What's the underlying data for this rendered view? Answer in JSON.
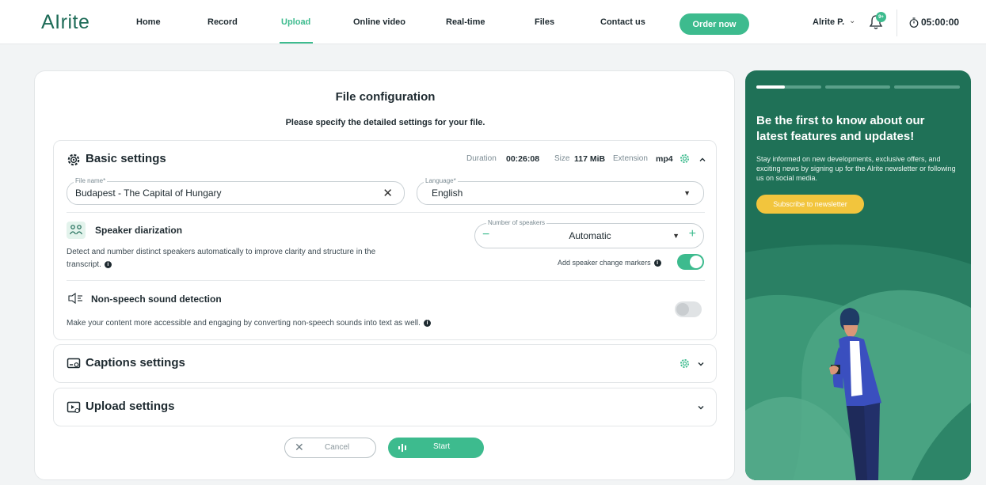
{
  "app": {
    "logo": "AIrite"
  },
  "nav": {
    "items": [
      {
        "label": "Home",
        "active": false
      },
      {
        "label": "Record",
        "active": false
      },
      {
        "label": "Upload",
        "active": true
      },
      {
        "label": "Online video",
        "active": false
      },
      {
        "label": "Real-time",
        "active": false
      },
      {
        "label": "Files",
        "active": false
      },
      {
        "label": "Contact us",
        "active": false
      }
    ],
    "order_button": "Order now",
    "user": "Alrite P.",
    "notification_badge": "9+",
    "timer": "05:00:00"
  },
  "main": {
    "title": "File configuration",
    "subtitle": "Please specify the detailed settings for your file."
  },
  "basic": {
    "heading": "Basic settings",
    "duration_label": "Duration",
    "duration_value": "00:26:08",
    "size_label": "Size",
    "size_value": "117 MiB",
    "extension_label": "Extension",
    "extension_value": "mp4",
    "file_name_label": "File name*",
    "file_name_value": "Budapest - The Capital of Hungary",
    "language_label": "Language*",
    "language_value": "English",
    "diarization": {
      "title": "Speaker diarization",
      "desc_line1": "Detect and number distinct speakers automatically to improve clarity and structure in the",
      "desc_line2": "transcript.",
      "speakers_label": "Number of speakers",
      "speakers_value": "Automatic",
      "marker_label": "Add speaker change markers",
      "marker_toggle": true
    },
    "nonspeech": {
      "title": "Non-speech sound detection",
      "desc": "Make your content more accessible and engaging by converting non-speech sounds into text as well.",
      "toggle": false
    }
  },
  "captions": {
    "heading": "Captions settings"
  },
  "upload": {
    "heading": "Upload settings"
  },
  "actions": {
    "cancel": "Cancel",
    "start": "Start"
  },
  "promo": {
    "title": "Be the first to know about our latest features and updates!",
    "text": "Stay informed on new developments, exclusive offers, and exciting news by signing up for the Alrite newsletter or following us on social media.",
    "button": "Subscribe to newsletter",
    "carousel_position": 1,
    "carousel_total": 3
  },
  "colors": {
    "accent": "#3dbb8e",
    "promo_bg": "#1f7157",
    "promo_button": "#f2c53d"
  }
}
